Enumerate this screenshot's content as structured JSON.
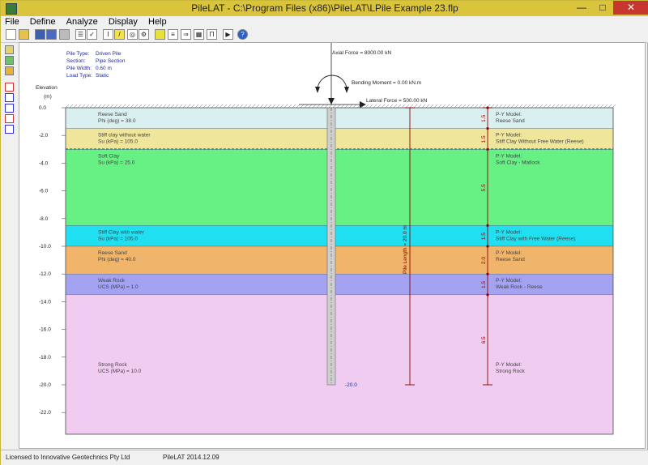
{
  "window": {
    "title": "PileLAT  -  C:\\Program Files (x86)\\PileLAT\\LPile Example 23.flp"
  },
  "menu": [
    "File",
    "Define",
    "Analyze",
    "Display",
    "Help"
  ],
  "info": {
    "labels": [
      "Pile Type:",
      "Section:",
      "Pile Width:",
      "Load Type:"
    ],
    "values": [
      "Driven Pile",
      "Pipe Section",
      "0.60 m",
      "Static"
    ]
  },
  "axis": {
    "title": "Elevation",
    "unit": "(m)",
    "ticks": [
      "0.0",
      "-2.0",
      "-4.0",
      "-6.0",
      "-8.0",
      "-10.0",
      "-12.0",
      "-14.0",
      "-16.0",
      "-18.0",
      "-20.0",
      "-22.0"
    ]
  },
  "loads": {
    "axial": "Axial Force = 8000.00 kN",
    "moment": "Bending Moment = 0.00 kN.m",
    "lateral": "Lateral Force = 500.00 kN"
  },
  "pile": {
    "length_label": "Pile Length = 20.0 m",
    "tip_label": "-20.0"
  },
  "layers": [
    {
      "name": "Reese Sand",
      "param": "Phi (deg) =  38.0",
      "model1": "P-Y Model:",
      "model2": "Reese Sand",
      "thickness": "1.5",
      "color": "#daf0f0"
    },
    {
      "name": "Stiff clay without water",
      "param": "Su (kPa) =  105.0",
      "model1": "P-Y Model:",
      "model2": "Stiff Clay Without Free Water (Reese)",
      "thickness": "1.5",
      "color": "#efe69b"
    },
    {
      "name": "Soft Clay",
      "param": "Su (kPa) =  25.0",
      "model1": "P-Y Model:",
      "model2": "Soft Clay - Matlock",
      "thickness": "5.5",
      "color": "#67f084"
    },
    {
      "name": "Stiff Clay with water",
      "param": "Su (kPa) =  105.0",
      "model1": "P-Y Model:",
      "model2": "Stiff Clay with Free Water (Reese)",
      "thickness": "1.5",
      "color": "#1fdff0"
    },
    {
      "name": "Reese Sand",
      "param": "Phi (deg) =  40.0",
      "model1": "P-Y Model:",
      "model2": "Reese Sand",
      "thickness": "2.0",
      "color": "#f0b56a"
    },
    {
      "name": "Weak Rock",
      "param": "UCS (MPa) =   1.0",
      "model1": "P-Y Model:",
      "model2": "Weak Rock - Reese",
      "thickness": "1.5",
      "color": "#a3a3f2"
    },
    {
      "name": "Strong Rock",
      "param": "UCS (MPa) =  10.0",
      "model1": "P-Y Model:",
      "model2": "Strong Rock",
      "thickness": "6.5",
      "color": "#f0cdf0"
    }
  ],
  "status": {
    "license": "Licensed to Innovative Geotechnics Pty Ltd",
    "version": "PileLAT 2014.12.09"
  }
}
